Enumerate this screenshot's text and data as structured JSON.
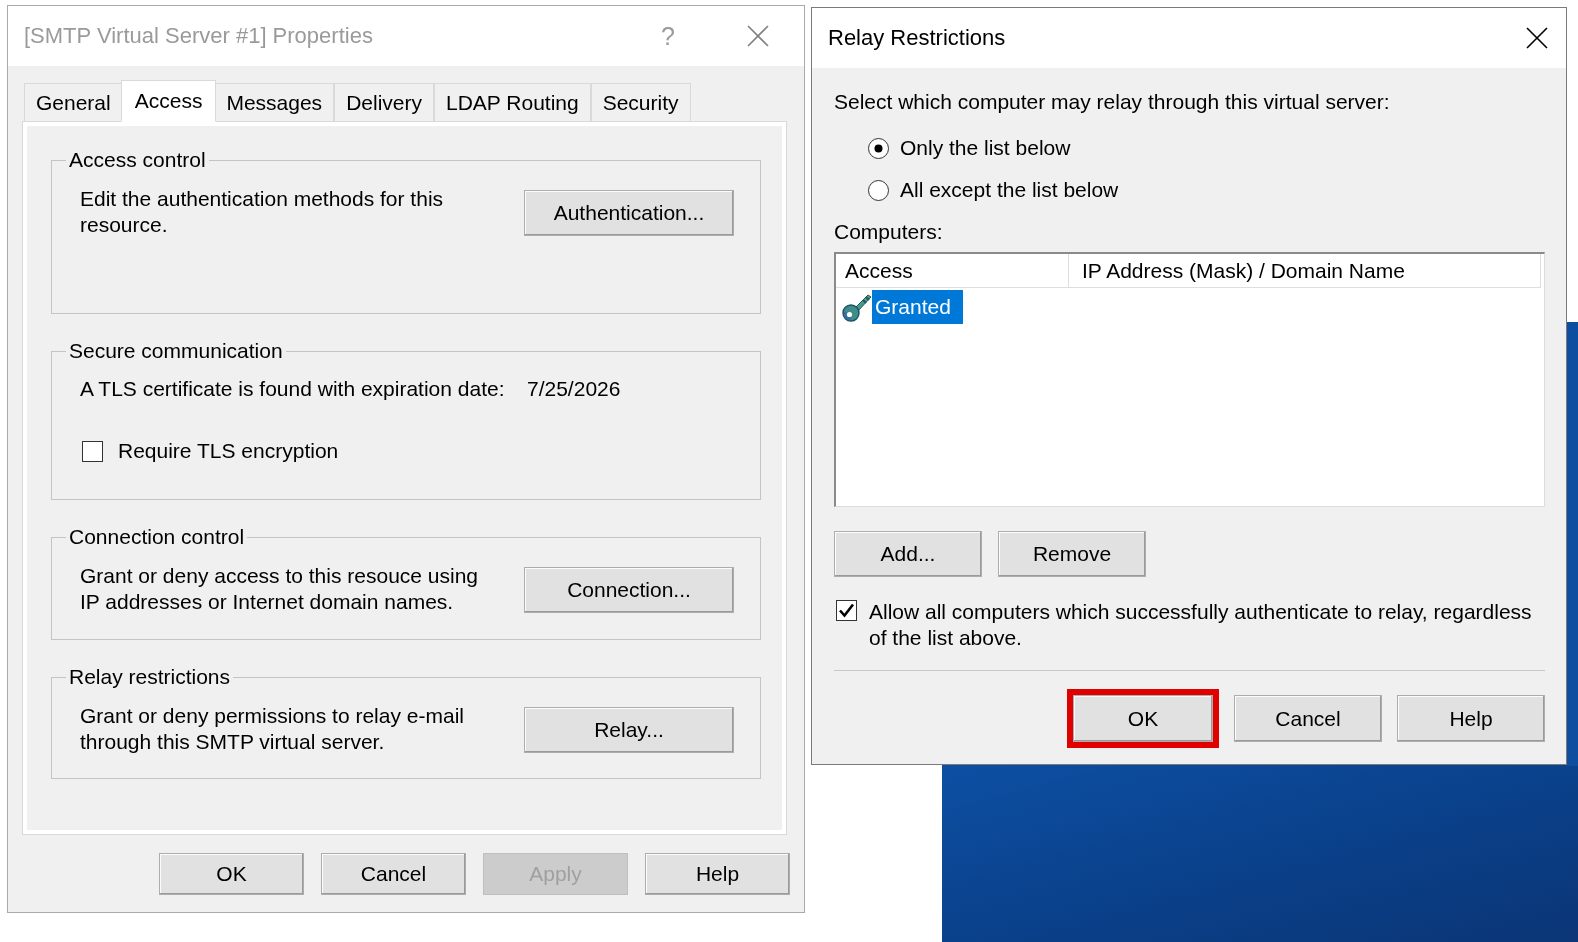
{
  "properties_dialog": {
    "title": "[SMTP Virtual Server #1] Properties",
    "active": false,
    "help_button": "?",
    "tabs": [
      {
        "label": "General",
        "selected": false
      },
      {
        "label": "Access",
        "selected": true
      },
      {
        "label": "Messages",
        "selected": false
      },
      {
        "label": "Delivery",
        "selected": false
      },
      {
        "label": "LDAP Routing",
        "selected": false
      },
      {
        "label": "Security",
        "selected": false
      }
    ],
    "groups": [
      {
        "kind": "action",
        "title": "Access control",
        "text": "Edit the authentication methods for this resource.",
        "button": "Authentication..."
      },
      {
        "kind": "certificate",
        "title": "Secure communication",
        "text": "A TLS certificate is found with expiration date:",
        "value": "7/25/2026",
        "checkbox": {
          "label": "Require TLS encryption",
          "checked": false
        }
      },
      {
        "kind": "action",
        "title": "Connection control",
        "text": "Grant or deny access to this resouce using IP addresses or Internet domain names.",
        "button": "Connection..."
      },
      {
        "kind": "action",
        "title": "Relay restrictions",
        "text": "Grant or deny permissions to relay e-mail through this SMTP virtual server.",
        "button": "Relay..."
      }
    ],
    "buttons": [
      {
        "label": "OK",
        "disabled": false
      },
      {
        "label": "Cancel",
        "disabled": false
      },
      {
        "label": "Apply",
        "disabled": true
      },
      {
        "label": "Help",
        "disabled": false
      }
    ]
  },
  "relay_dialog": {
    "title": "Relay Restrictions",
    "active": true,
    "prompt": "Select which computer may relay through this virtual server:",
    "options": [
      {
        "label": "Only the list below",
        "selected": true
      },
      {
        "label": "All except the list below",
        "selected": false
      }
    ],
    "list_label": "Computers:",
    "table": {
      "columns": [
        "Access",
        "IP Address (Mask) / Domain Name"
      ],
      "rows": [
        {
          "access": "Granted",
          "selected": true
        }
      ]
    },
    "list_buttons": [
      "Add...",
      "Remove"
    ],
    "allow_authenticated": {
      "label": "Allow all computers which successfully authenticate to relay, regardless of the list above.",
      "checked": true
    },
    "buttons": [
      {
        "label": "OK",
        "highlighted": true
      },
      {
        "label": "Cancel",
        "highlighted": false
      },
      {
        "label": "Help",
        "highlighted": false
      }
    ]
  }
}
